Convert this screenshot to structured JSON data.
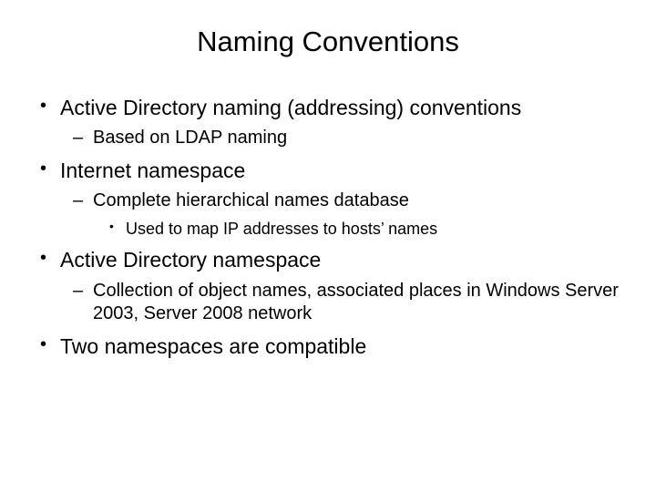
{
  "title": "Naming Conventions",
  "bullets": {
    "b1": "Active Directory naming (addressing) conventions",
    "b1_1": "Based on LDAP naming",
    "b2": "Internet namespace",
    "b2_1": "Complete hierarchical names database",
    "b2_1_1": "Used to map IP addresses to hosts’ names",
    "b3": "Active Directory namespace",
    "b3_1": "Collection of object names, associated places in Windows Server 2003, Server 2008 network",
    "b4": "Two namespaces are compatible"
  }
}
